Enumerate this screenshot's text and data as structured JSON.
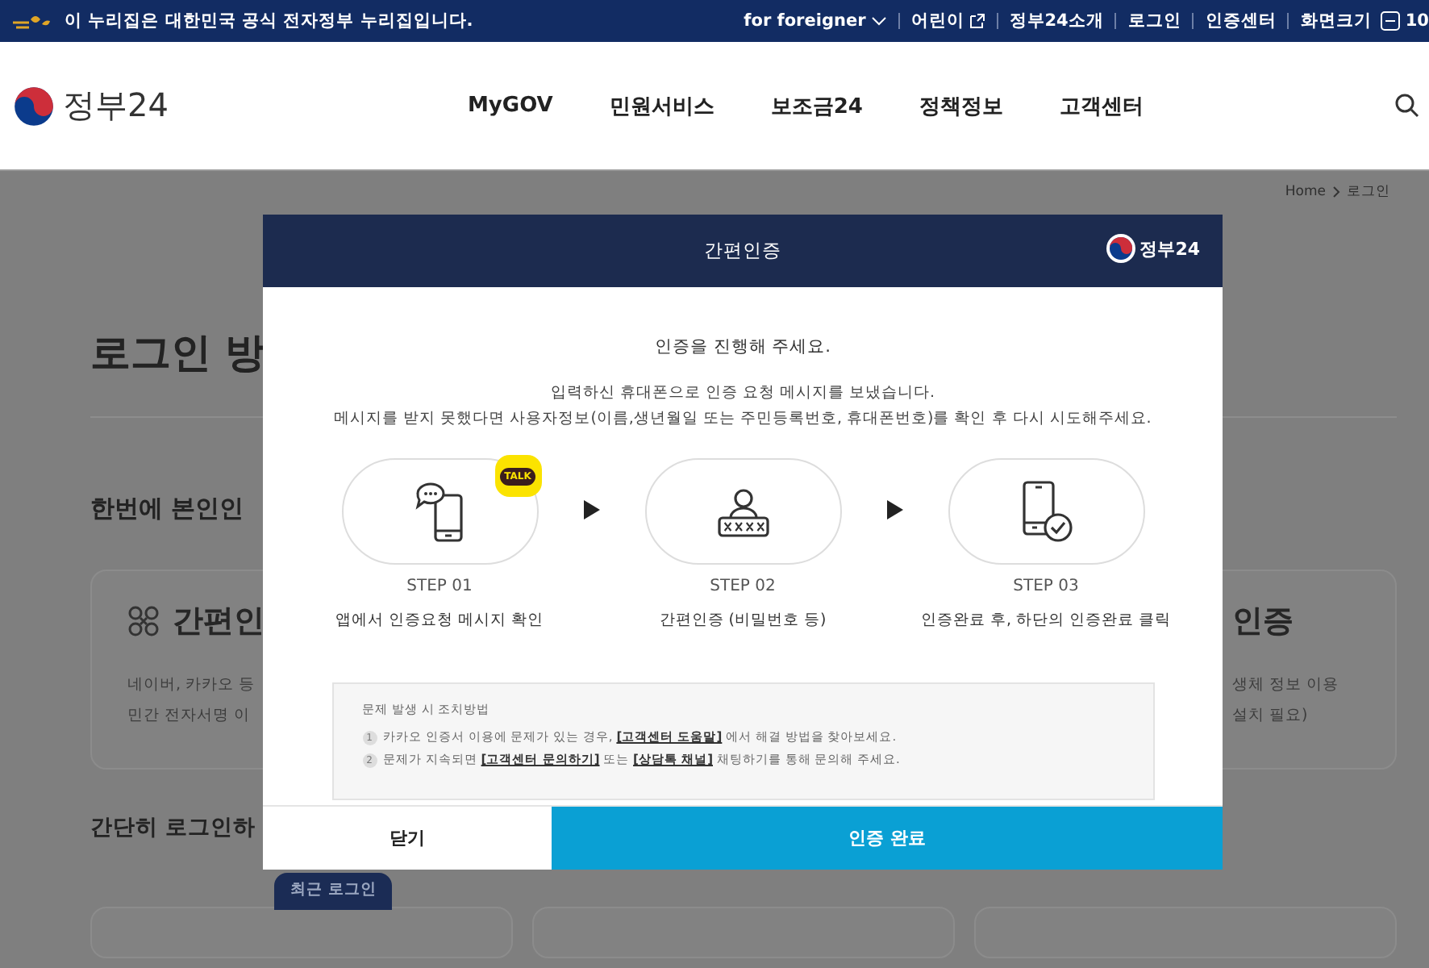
{
  "top_bar": {
    "notice": "이 누리집은 대한민국 공식 전자정부 누리집입니다.",
    "links": [
      {
        "label": "for foreigner",
        "kind": "dropdown"
      },
      {
        "label": "어린이",
        "kind": "external"
      },
      {
        "label": "정부24소개",
        "kind": "plain"
      },
      {
        "label": "로그인",
        "kind": "plain"
      },
      {
        "label": "인증센터",
        "kind": "plain"
      },
      {
        "label": "화면크기",
        "kind": "plain"
      }
    ],
    "zoom_value": "10"
  },
  "header": {
    "logo_text": "정부24",
    "nav": [
      "MyGOV",
      "민원서비스",
      "보조금24",
      "정책정보",
      "고객센터"
    ]
  },
  "breadcrumb": [
    "Home",
    "로그인"
  ],
  "page": {
    "title": "로그인 방",
    "section_title": "한번에 본인인",
    "cards": [
      {
        "title": "간편인",
        "lines": [
          "네이버, 카카오 등",
          "민간 전자서명 이"
        ]
      },
      {
        "title": "인증",
        "lines": [
          "생체 정보 이용",
          "설치 필요)"
        ]
      }
    ],
    "section2_title": "간단히 로그인하",
    "recent_badge": "최근 로그인"
  },
  "modal": {
    "title": "간편인증",
    "logo_text": "정부24",
    "heading": "인증을 진행해 주세요.",
    "message_lines": [
      "입력하신 휴대폰으로 인증 요청 메시지를 보냈습니다.",
      "메시지를 받지 못했다면 사용자정보(이름,생년월일 또는 주민등록번호, 휴대폰번호)를 확인 후 다시 시도해주세요."
    ],
    "steps": [
      {
        "label": "STEP 01",
        "description": "앱에서 인증요청 메시지 확인",
        "kind": "chat-phone",
        "badge": "TALK"
      },
      {
        "label": "STEP 02",
        "description": "간편인증 (비밀번호 등)",
        "kind": "password"
      },
      {
        "label": "STEP 03",
        "description": "인증완료 후, 하단의 인증완료 클릭",
        "kind": "phone-check"
      }
    ],
    "help": {
      "title": "문제 발생 시 조치방법",
      "items": [
        {
          "number": "1",
          "parts": [
            {
              "kind": "text",
              "text": "카카오 인증서 이용에 문제가 있는 경우, "
            },
            {
              "kind": "link",
              "text": "[고객센터 도움말]"
            },
            {
              "kind": "text",
              "text": " 에서 해결 방법을 찾아보세요."
            }
          ]
        },
        {
          "number": "2",
          "parts": [
            {
              "kind": "text",
              "text": "문제가 지속되면 "
            },
            {
              "kind": "link",
              "text": "[고객센터 문의하기]"
            },
            {
              "kind": "text",
              "text": " 또는 "
            },
            {
              "kind": "link",
              "text": "[상담톡 채널]"
            },
            {
              "kind": "text",
              "text": " 채팅하기를 통해 문의해 주세요."
            }
          ]
        }
      ]
    },
    "buttons": [
      {
        "label": "닫기",
        "kind": "secondary"
      },
      {
        "label": "인증 완료",
        "kind": "primary"
      }
    ]
  }
}
